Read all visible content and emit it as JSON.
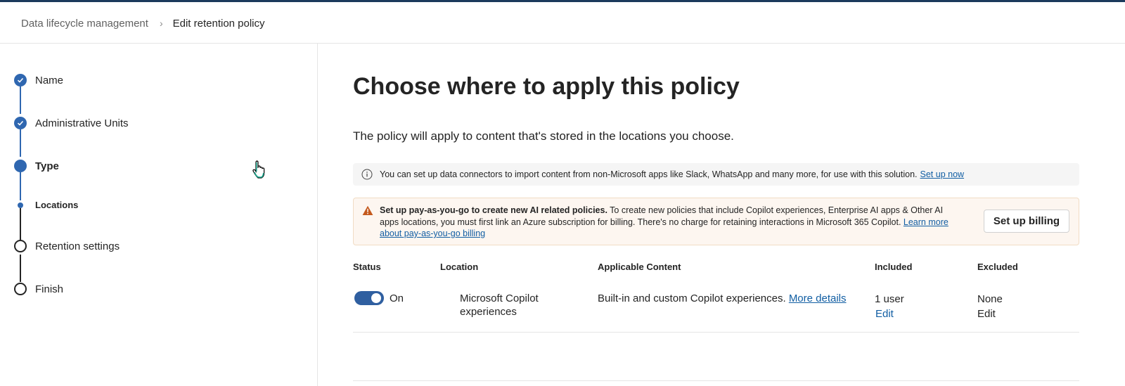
{
  "breadcrumb": {
    "parent": "Data lifecycle management",
    "current": "Edit retention policy"
  },
  "steps": [
    {
      "label": "Name",
      "state": "done"
    },
    {
      "label": "Administrative Units",
      "state": "done"
    },
    {
      "label": "Type",
      "state": "current"
    },
    {
      "label": "Locations",
      "state": "sub-current"
    },
    {
      "label": "Retention settings",
      "state": "pending"
    },
    {
      "label": "Finish",
      "state": "pending"
    }
  ],
  "main": {
    "title": "Choose where to apply this policy",
    "subtitle": "The policy will apply to content that's stored in the locations you choose.",
    "info": {
      "text": "You can set up data connectors to import content from non-Microsoft apps like Slack, WhatsApp and many more, for use with this solution.",
      "link": "Set up now"
    },
    "warning": {
      "bold": "Set up pay-as-you-go to create new AI related policies.",
      "text": "To create new policies that include Copilot experiences, Enterprise AI apps & Other AI apps locations, you must first link an Azure subscription for billing. There's no charge for retaining interactions in Microsoft 365 Copilot.",
      "link": "Learn more about pay-as-you-go billing",
      "button": "Set up billing"
    },
    "table": {
      "headers": {
        "status": "Status",
        "location": "Location",
        "content": "Applicable Content",
        "included": "Included",
        "excluded": "Excluded"
      },
      "rows": [
        {
          "status": "On",
          "toggle_on": true,
          "location": "Microsoft Copilot experiences",
          "content": "Built-in and custom Copilot experiences.",
          "content_link": "More details",
          "included": "1 user",
          "included_edit": "Edit",
          "excluded": "None",
          "excluded_edit": "Edit"
        }
      ]
    }
  },
  "colors": {
    "accent": "#2f67b0",
    "link": "#115ea3",
    "warning_bg": "#fdf6f0",
    "warning_icon": "#c4591d"
  }
}
